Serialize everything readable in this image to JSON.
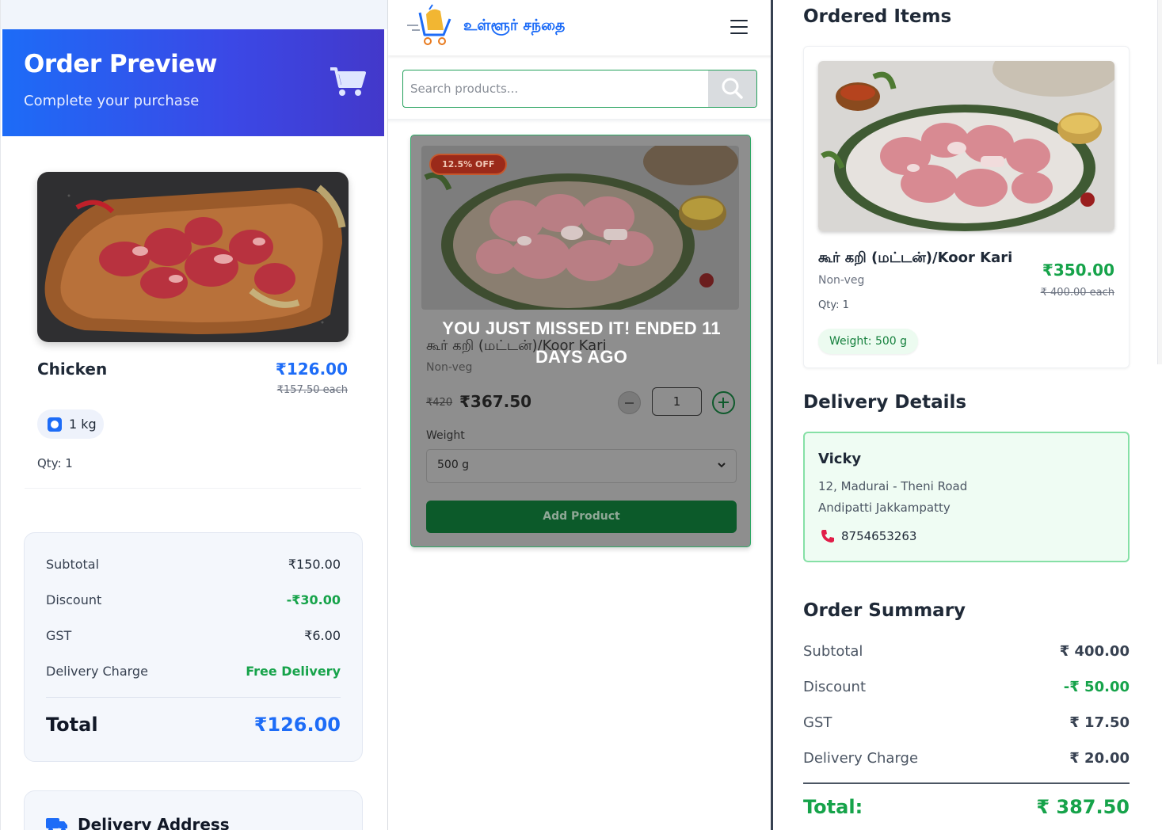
{
  "left": {
    "header": {
      "title": "Order Preview",
      "subtitle": "Complete your purchase",
      "icon": "cart-icon"
    },
    "item": {
      "name": "Chicken",
      "price": "₹126.00",
      "each": "₹157.50 each",
      "weight": "1 kg",
      "qty": "Qty: 1"
    },
    "summary": {
      "subtotal_label": "Subtotal",
      "subtotal": "₹150.00",
      "discount_label": "Discount",
      "discount": "-₹30.00",
      "gst_label": "GST",
      "gst": "₹6.00",
      "delivery_label": "Delivery Charge",
      "delivery": "Free Delivery",
      "total_label": "Total",
      "total": "₹126.00"
    },
    "address_title": "Delivery Address"
  },
  "middle": {
    "brand": "உள்ளூர் சந்தை",
    "search": {
      "placeholder": "Search products..."
    },
    "product": {
      "badge": "12.5% OFF",
      "ended_message": "YOU JUST MISSED IT! ENDED 11 DAYS AGO",
      "name": "கூர் கறி (மட்டன்)/Koor Kari",
      "type": "Non-veg",
      "old_price": "₹420",
      "price": "₹367.50",
      "quantity": "1",
      "weight_label": "Weight",
      "weight_value": "500 g",
      "add_label": "Add Product"
    }
  },
  "right": {
    "ordered_title": "Ordered Items",
    "item": {
      "name": "கூர் கறி (மட்டன்)/Koor Kari",
      "type": "Non-veg",
      "qty": "Qty: 1",
      "price": "₹350.00",
      "each": "₹ 400.00 each",
      "weight": "Weight: 500 g"
    },
    "delivery_title": "Delivery Details",
    "delivery": {
      "name": "Vicky",
      "line1": "12, Madurai - Theni Road",
      "line2": "Andipatti Jakkampatty",
      "phone": "8754653263"
    },
    "summary_title": "Order Summary",
    "summary": {
      "subtotal_label": "Subtotal",
      "subtotal": "₹ 400.00",
      "discount_label": "Discount",
      "discount": "-₹ 50.00",
      "gst_label": "GST",
      "gst": "₹ 17.50",
      "delivery_label": "Delivery Charge",
      "delivery": "₹ 20.00",
      "total_label": "Total:",
      "total": "₹ 387.50"
    }
  },
  "colors": {
    "primary_blue": "#1d6cf7",
    "green": "#16a34a",
    "dark_green_button": "#0c5a2a",
    "discount_green": "#16a34a"
  }
}
